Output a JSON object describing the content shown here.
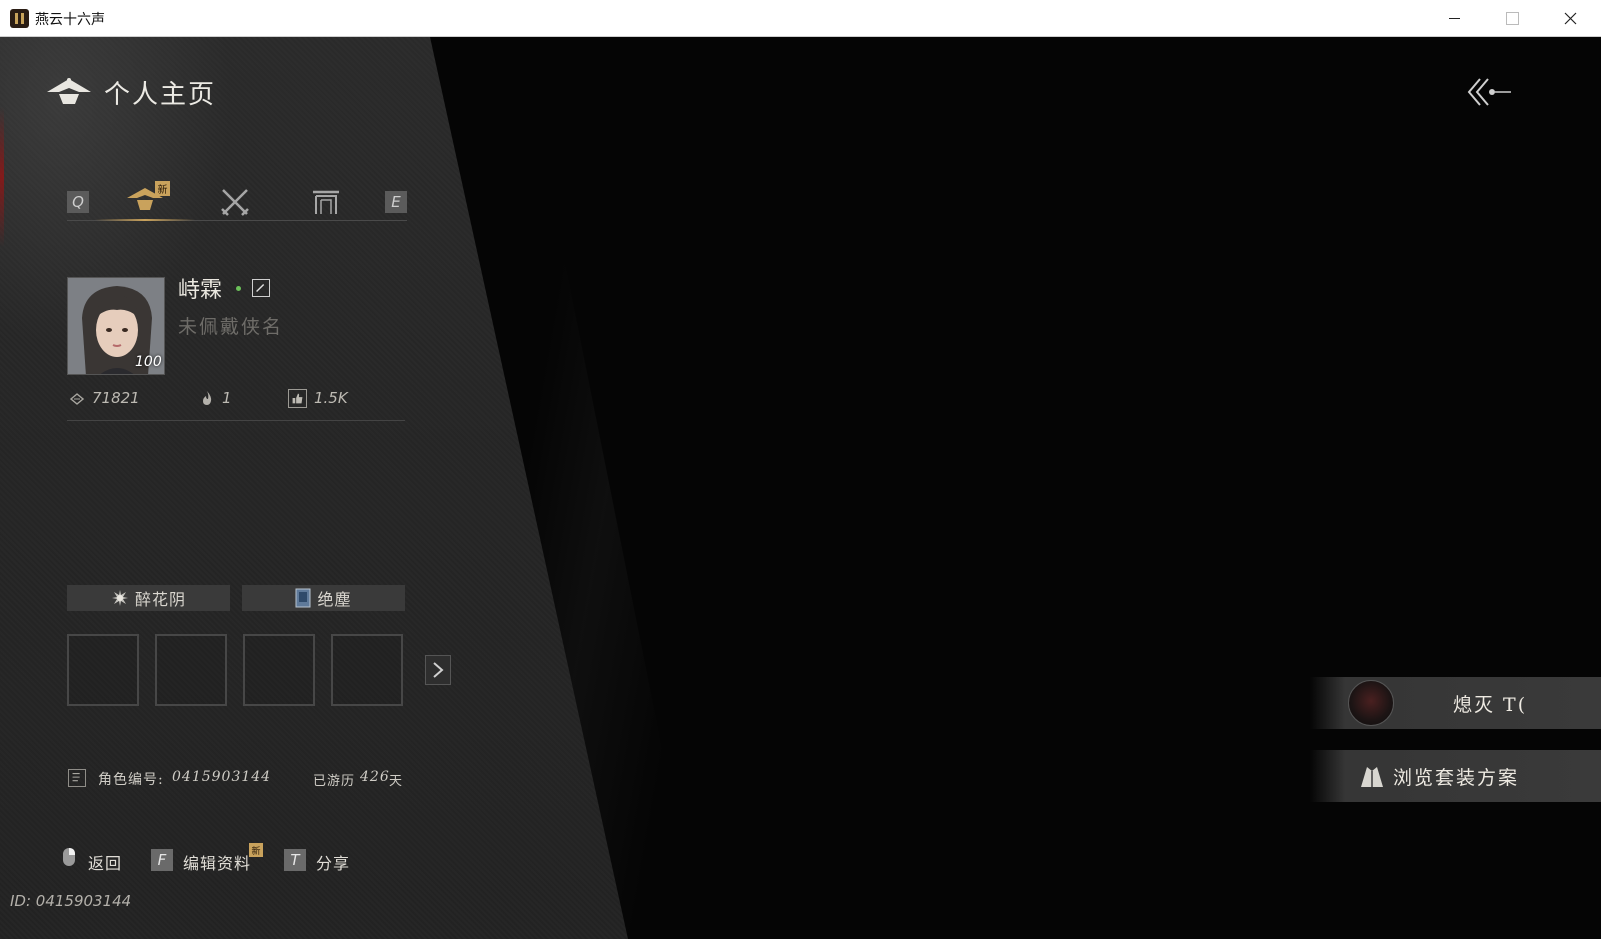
{
  "window": {
    "title": "燕云十六声"
  },
  "header": {
    "title": "个人主页",
    "back_icon": "back-arrow-icon"
  },
  "tabs": {
    "left_key": "Q",
    "right_key": "E",
    "items": [
      {
        "icon": "hat-icon",
        "active": true,
        "badge": "新"
      },
      {
        "icon": "crossed-swords-icon",
        "active": false
      },
      {
        "icon": "gate-icon",
        "active": false
      }
    ]
  },
  "profile": {
    "name": "峙霖",
    "title_placeholder": "未佩戴侠名",
    "level": "100",
    "stats": [
      {
        "icon": "rank-icon",
        "value": "71821"
      },
      {
        "icon": "flame-icon",
        "value": "1"
      },
      {
        "icon": "thumbs-up-icon",
        "value": "1.5K"
      }
    ]
  },
  "sects": [
    {
      "icon": "flower-icon",
      "label": "醉花阴"
    },
    {
      "icon": "scroll-icon",
      "label": "绝塵"
    }
  ],
  "character": {
    "id_label": "角色编号:",
    "id_value": "0415903144",
    "days_prefix": "已游历",
    "days_value": "426",
    "days_suffix": "天"
  },
  "footer": {
    "back_label": "返回",
    "edit_key": "F",
    "edit_label": "编辑资料",
    "edit_badge": "新",
    "share_key": "T",
    "share_label": "分享",
    "id_line": "ID: 0415903144"
  },
  "side": {
    "emote_label": "熄灭 T(",
    "outfit_label": "浏览套装方案"
  },
  "colors": {
    "accent_gold": "#c9a25c",
    "online_green": "#6cc25a",
    "panel": "#272727"
  }
}
